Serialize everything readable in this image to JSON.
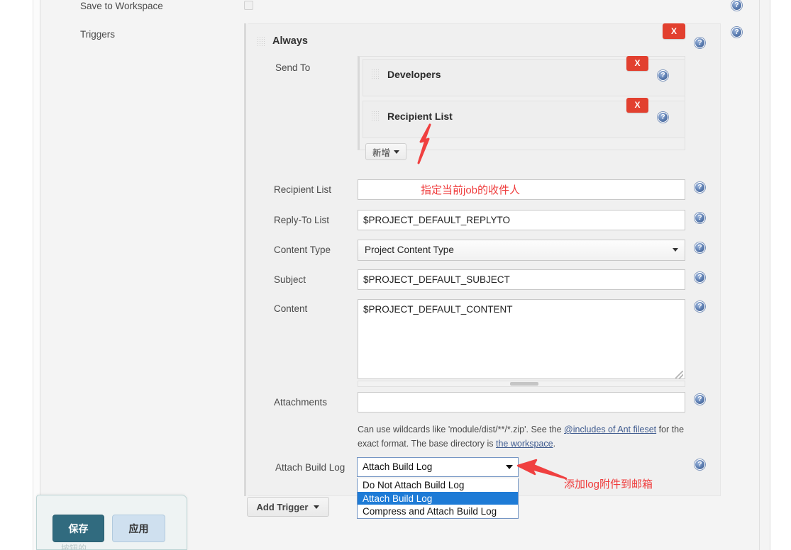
{
  "form": {
    "save_to_workspace_label": "Save to Workspace",
    "triggers_label": "Triggers"
  },
  "trigger": {
    "title": "Always",
    "send_to_label": "Send To",
    "recipients": [
      {
        "name": "Developers",
        "remove_label": "X"
      },
      {
        "name": "Recipient List",
        "remove_label": "X"
      }
    ],
    "add_button_label": "新增",
    "remove_label": "X"
  },
  "fields": {
    "recipient_list": {
      "label": "Recipient List",
      "value": "",
      "placeholder": ""
    },
    "reply_to_list": {
      "label": "Reply-To List",
      "value": "$PROJECT_DEFAULT_REPLYTO"
    },
    "content_type": {
      "label": "Content Type",
      "value": "Project Content Type"
    },
    "subject": {
      "label": "Subject",
      "value": "$PROJECT_DEFAULT_SUBJECT"
    },
    "content": {
      "label": "Content",
      "value": "$PROJECT_DEFAULT_CONTENT"
    },
    "attachments": {
      "label": "Attachments",
      "value": ""
    },
    "attach_build_log": {
      "label": "Attach Build Log",
      "value": "Attach Build Log",
      "options": [
        "Do Not Attach Build Log",
        "Attach Build Log",
        "Compress and Attach Build Log"
      ],
      "selected_index": 1
    }
  },
  "help_text": {
    "part1": "Can use wildcards like 'module/dist/**/*.zip'. See the ",
    "link1": "@includes of Ant fileset",
    "part2": " for the exact format. The base directory is ",
    "link2": "the workspace",
    "part3": "."
  },
  "buttons": {
    "add_trigger": "Add Trigger",
    "save": "保存",
    "apply": "应用",
    "save_hint": "按钮的..."
  },
  "annotations": {
    "recipient_note": "指定当前job的收件人",
    "attach_log_note": "添加log附件到邮箱",
    "arrow_color": "#f04040"
  },
  "icons": {
    "help": "?",
    "drag_handle": "drag-handle-icon",
    "caret": "▼"
  },
  "colors": {
    "accent_red": "#e2402f",
    "annotation_red": "#ef3b3b",
    "select_highlight": "#1e7bd6",
    "save_button": "#316b7f",
    "apply_button": "#cfe0ef",
    "page_bg": "#f4f4f4"
  }
}
